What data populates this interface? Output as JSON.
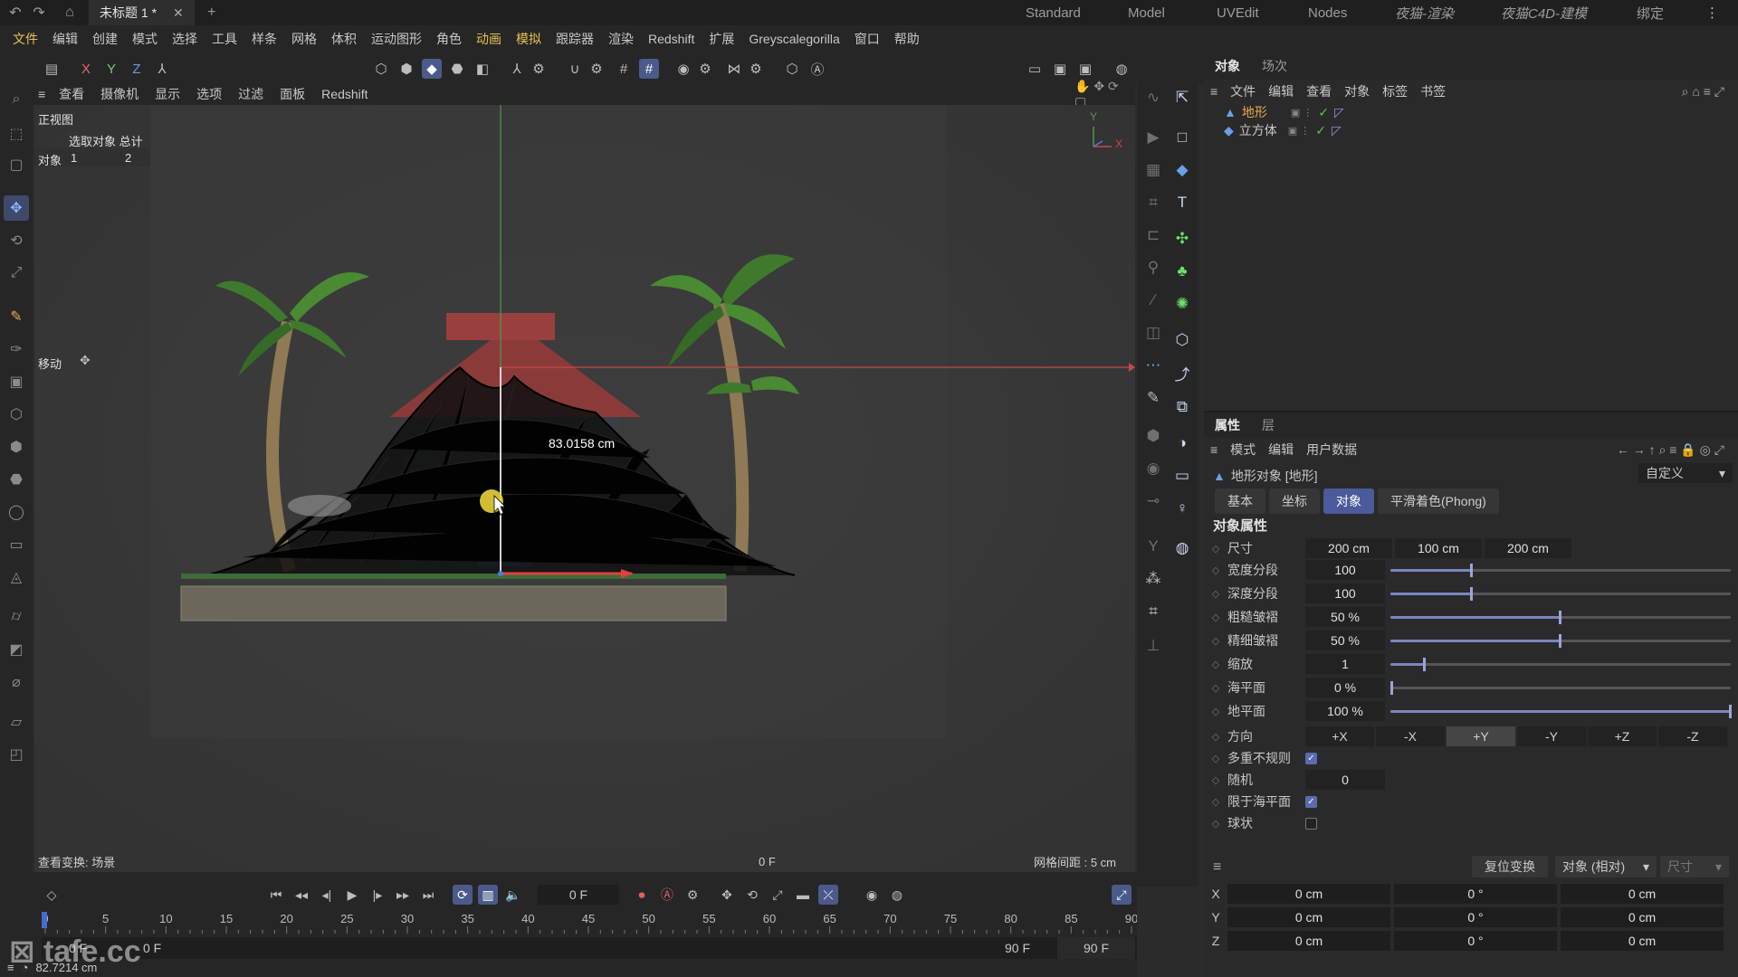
{
  "titlebar": {
    "tab_title": "未标题 1 *",
    "workspaces": [
      "Standard",
      "Model",
      "UVEdit",
      "Nodes",
      "夜猫-渲染",
      "夜猫C4D-建模",
      "绑定"
    ]
  },
  "menubar": [
    "文件",
    "编辑",
    "创建",
    "模式",
    "选择",
    "工具",
    "样条",
    "网格",
    "体积",
    "运动图形",
    "角色",
    "动画",
    "模拟",
    "跟踪器",
    "渲染",
    "Redshift",
    "扩展",
    "Greyscalegorilla",
    "窗口",
    "帮助"
  ],
  "viewport": {
    "menu": [
      "查看",
      "摄像机",
      "显示",
      "选项",
      "过滤",
      "面板",
      "Redshift"
    ],
    "view_name": "正视图",
    "stats_header": "选取对象 总计",
    "stats_label": "对象",
    "stats_selected": "1",
    "stats_total": "2",
    "tool_label": "移动",
    "measure": "83.0158 cm",
    "axis_y": "Y",
    "axis_x": "X",
    "status_left": "查看变换: 场景",
    "status_mid": "0 F",
    "status_right": "网格间距 : 5 cm"
  },
  "object_manager": {
    "tabs": [
      "对象",
      "场次"
    ],
    "menu": [
      "文件",
      "编辑",
      "查看",
      "对象",
      "标签",
      "书签"
    ],
    "objects": [
      {
        "name": "地形",
        "selected": true
      },
      {
        "name": "立方体",
        "selected": false
      }
    ]
  },
  "attributes": {
    "tabs": [
      "属性",
      "层"
    ],
    "menu": [
      "模式",
      "编辑",
      "用户数据"
    ],
    "object_title": "地形对象 [地形]",
    "preset": "自定义",
    "subtabs": [
      "基本",
      "坐标",
      "对象",
      "平滑着色(Phong)"
    ],
    "active_subtab": "对象",
    "section": "对象属性",
    "size_label": "尺寸",
    "size": [
      "200 cm",
      "100 cm",
      "200 cm"
    ],
    "params": [
      {
        "label": "宽度分段",
        "value": "100",
        "level": 0.24
      },
      {
        "label": "深度分段",
        "value": "100",
        "level": 0.24
      },
      {
        "label": "粗糙皱褶",
        "value": "50 %",
        "level": 0.5
      },
      {
        "label": "精细皱褶",
        "value": "50 %",
        "level": 0.5
      },
      {
        "label": "缩放",
        "value": "1",
        "level": 0.1
      },
      {
        "label": "海平面",
        "value": "0 %",
        "level": 0.0
      },
      {
        "label": "地平面",
        "value": "100 %",
        "level": 1.0
      }
    ],
    "direction_label": "方向",
    "directions": [
      "+X",
      "-X",
      "+Y",
      "-Y",
      "+Z",
      "-Z"
    ],
    "active_direction": "+Y",
    "multi_irregular_label": "多重不规则",
    "multi_irregular": true,
    "random_label": "随机",
    "random": "0",
    "limit_sea_label": "限于海平面",
    "limit_sea": true,
    "spherical_label": "球状",
    "spherical": false
  },
  "coords": {
    "reset_label": "复位变换",
    "mode": "对象 (相对)",
    "size_label": "尺寸",
    "rows": [
      {
        "axis": "X",
        "pos": "0 cm",
        "rot": "0 °",
        "size": "0 cm"
      },
      {
        "axis": "Y",
        "pos": "0 cm",
        "rot": "0 °",
        "size": "0 cm"
      },
      {
        "axis": "Z",
        "pos": "0 cm",
        "rot": "0 °",
        "size": "0 cm"
      }
    ]
  },
  "timeline": {
    "current_frame": "0 F",
    "ticks": [
      "0",
      "5",
      "10",
      "15",
      "20",
      "25",
      "30",
      "35",
      "40",
      "45",
      "50",
      "55",
      "60",
      "65",
      "70",
      "75",
      "80",
      "85",
      "90"
    ],
    "start": "0 F",
    "start2": "0 F",
    "end": "90 F",
    "end2": "90 F"
  },
  "statusbar": {
    "value": "82.7214 cm",
    "watermark": "tafe.cc"
  }
}
